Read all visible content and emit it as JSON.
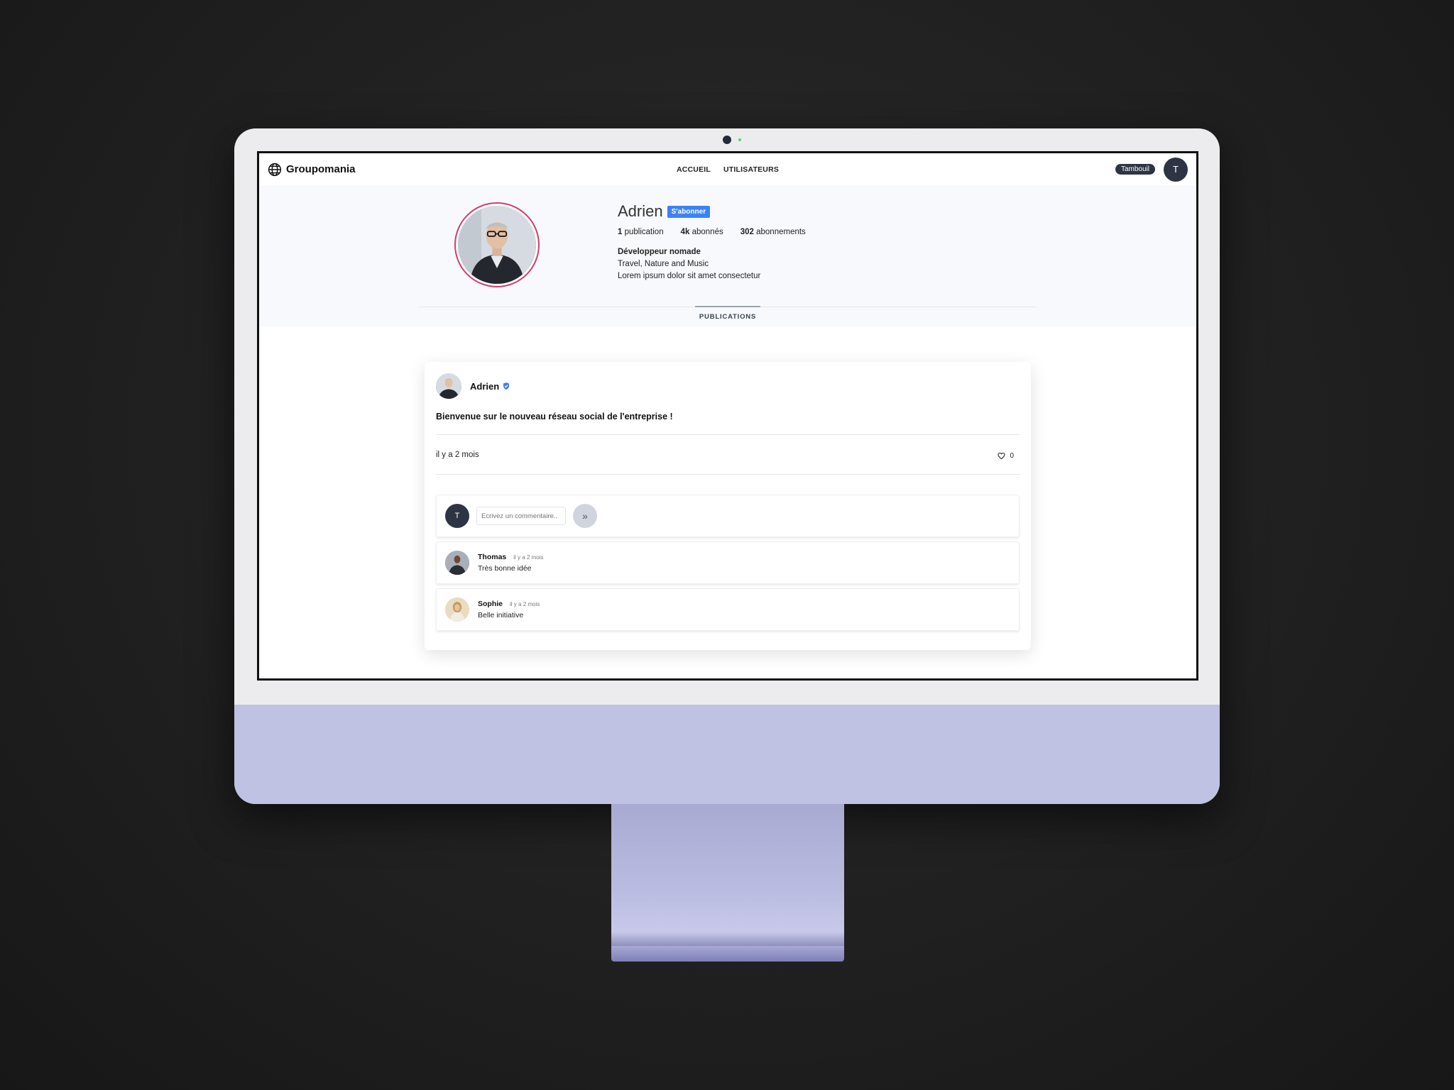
{
  "app": {
    "brand": "Groupomania",
    "nav": [
      "ACCUEIL",
      "UTILISATEURS"
    ],
    "current_user": {
      "username": "Tambouil",
      "initial": "T"
    }
  },
  "profile": {
    "name": "Adrien",
    "subscribe_label": "S'abonner",
    "stats": [
      {
        "value": "1",
        "label": "publication"
      },
      {
        "value": "4k",
        "label": "abonnés"
      },
      {
        "value": "302",
        "label": "abonnements"
      }
    ],
    "bio": {
      "title": "Développeur nomade",
      "lines": [
        "Travel, Nature and Music",
        "Lorem ipsum dolor sit amet consectetur"
      ]
    },
    "active_tab": "PUBLICATIONS"
  },
  "post": {
    "author": "Adrien",
    "text": "Bienvenue sur le nouveau réseau social de l'entreprise !",
    "time": "il y a 2 mois",
    "likes": "0",
    "comment_placeholder": "Ecrivez un commentaire..",
    "comments": [
      {
        "author": "Thomas",
        "time": "il y a 2 mois",
        "text": "Très bonne idée"
      },
      {
        "author": "Sophie",
        "time": "il y a 2 mois",
        "text": "Belle initiative"
      }
    ]
  },
  "colors": {
    "accent": "#3b82f6",
    "dark": "#2d3443",
    "avatar_ring": "#d83a6a",
    "imac_chin": "#bfc2e2"
  }
}
